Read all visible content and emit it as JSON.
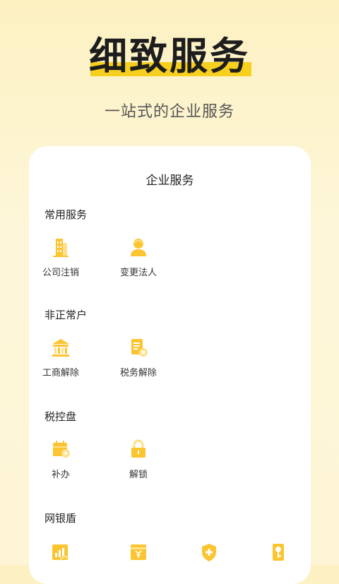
{
  "hero": {
    "title": "细致服务",
    "subtitle": "一站式的企业服务"
  },
  "card": {
    "title": "企业服务",
    "sections": [
      {
        "title": "常用服务",
        "items": [
          {
            "label": "公司注销",
            "icon": "building-icon"
          },
          {
            "label": "变更法人",
            "icon": "person-icon"
          }
        ]
      },
      {
        "title": "非正常户",
        "items": [
          {
            "label": "工商解除",
            "icon": "bank-icon"
          },
          {
            "label": "税务解除",
            "icon": "tax-document-icon"
          }
        ]
      },
      {
        "title": "税控盘",
        "items": [
          {
            "label": "补办",
            "icon": "calendar-add-icon"
          },
          {
            "label": "解锁",
            "icon": "lock-icon"
          }
        ]
      },
      {
        "title": "网银盾",
        "items": [
          {
            "icon": "chart-icon"
          },
          {
            "icon": "yuan-card-icon"
          },
          {
            "icon": "shield-plus-icon"
          },
          {
            "icon": "key-icon"
          }
        ]
      }
    ]
  },
  "colors": {
    "accent": "#f7cf1e",
    "icon_primary": "#fbc431",
    "icon_light": "#fde08a"
  }
}
